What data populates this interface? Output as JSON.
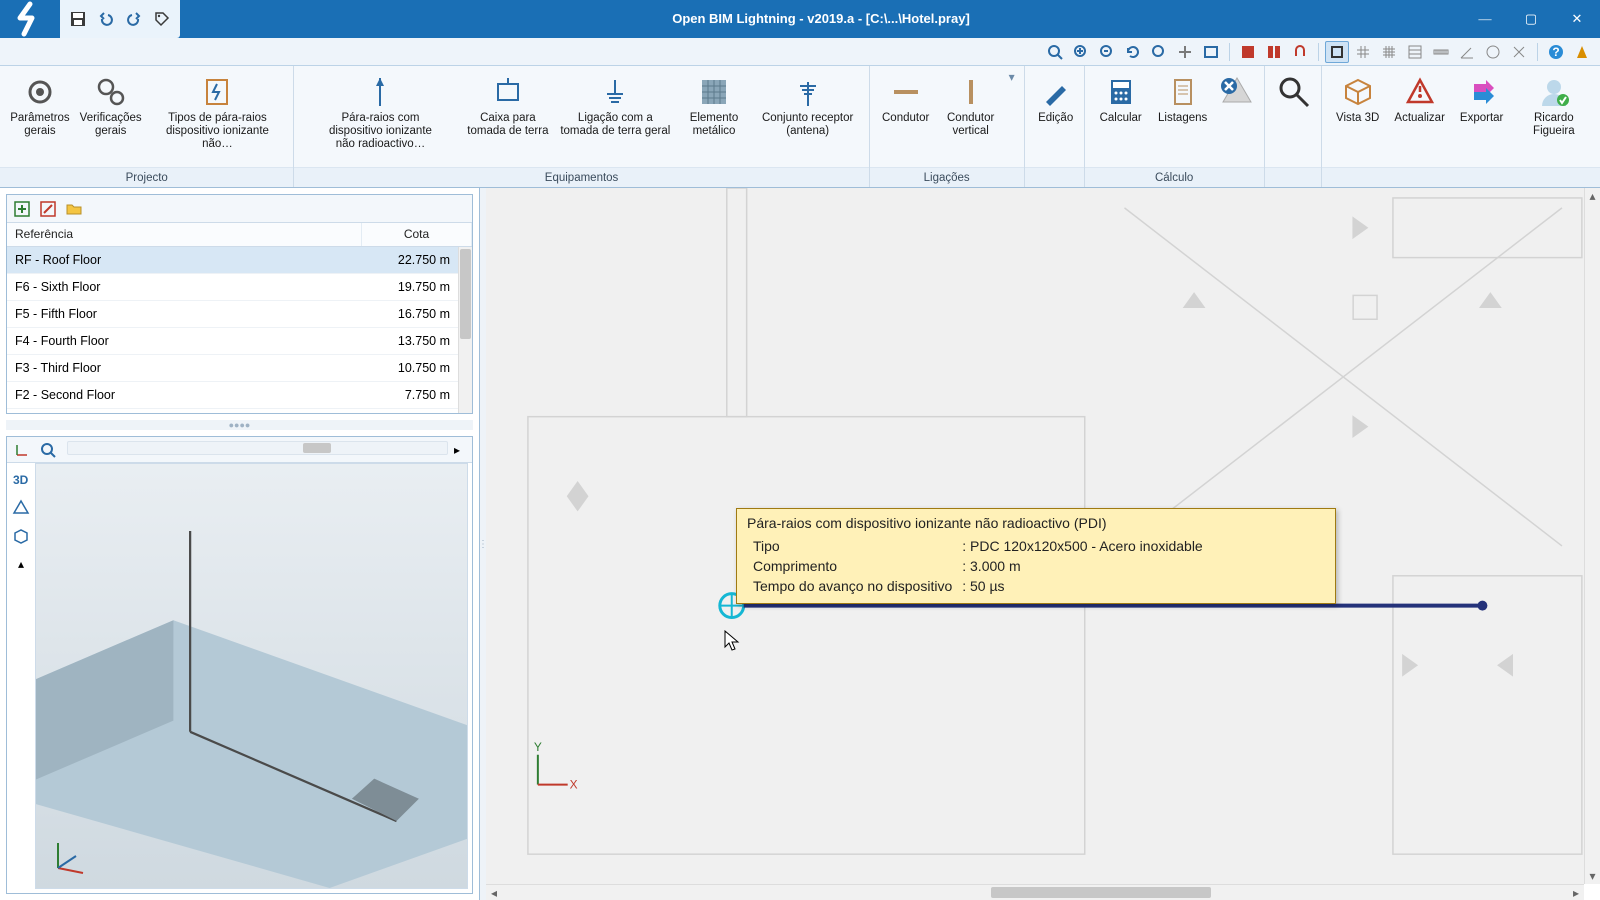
{
  "app": {
    "title": "Open BIM Lightning - v2019.a - [C:\\...\\Hotel.pray]"
  },
  "ribbon": {
    "groups": [
      {
        "label": "Projecto",
        "buttons": [
          "Parâmetros gerais",
          "Verificações gerais",
          "Tipos de pára-raios dispositivo ionizante não…"
        ]
      },
      {
        "label": "Equipamentos",
        "buttons": [
          "Pára-raios com dispositivo ionizante não radioactivo…",
          "Caixa para tomada de terra",
          "Ligação com a tomada de terra geral",
          "Elemento metálico",
          "Conjunto receptor (antena)"
        ]
      },
      {
        "label": "Ligações",
        "buttons": [
          "Condutor",
          "Condutor vertical"
        ]
      },
      {
        "label": "",
        "buttons": [
          "Edição"
        ]
      },
      {
        "label": "Cálculo",
        "buttons": [
          "Calcular",
          "Listagens"
        ]
      },
      {
        "label": "",
        "buttons": [
          "",
          "",
          "Vista 3D",
          "Actualizar",
          "Exportar",
          "Ricardo Figueira"
        ]
      }
    ]
  },
  "tree": {
    "head_ref": "Referência",
    "head_cota": "Cota",
    "rows": [
      {
        "ref": "RF - Roof Floor",
        "cota": "22.750 m",
        "sel": true
      },
      {
        "ref": "F6 - Sixth Floor",
        "cota": "19.750 m"
      },
      {
        "ref": "F5 - Fifth Floor",
        "cota": "16.750 m"
      },
      {
        "ref": "F4 - Fourth Floor",
        "cota": "13.750 m"
      },
      {
        "ref": "F3 - Third Floor",
        "cota": "10.750 m"
      },
      {
        "ref": "F2 - Second Floor",
        "cota": "7.750 m"
      }
    ]
  },
  "tooltip": {
    "title": "Pára-raios com dispositivo ionizante não radioactivo (PDI)",
    "rows": [
      {
        "k": "Tipo",
        "v": "PDC 120x120x500 - Acero inoxidable"
      },
      {
        "k": "Comprimento",
        "v": "3.000 m"
      },
      {
        "k": "Tempo do avanço no dispositivo",
        "v": "50 µs"
      }
    ]
  },
  "axis": {
    "x": "X",
    "y": "Y"
  },
  "scroll": {
    "left": "◂",
    "right": "▸",
    "up": "▴",
    "down": "▾"
  }
}
